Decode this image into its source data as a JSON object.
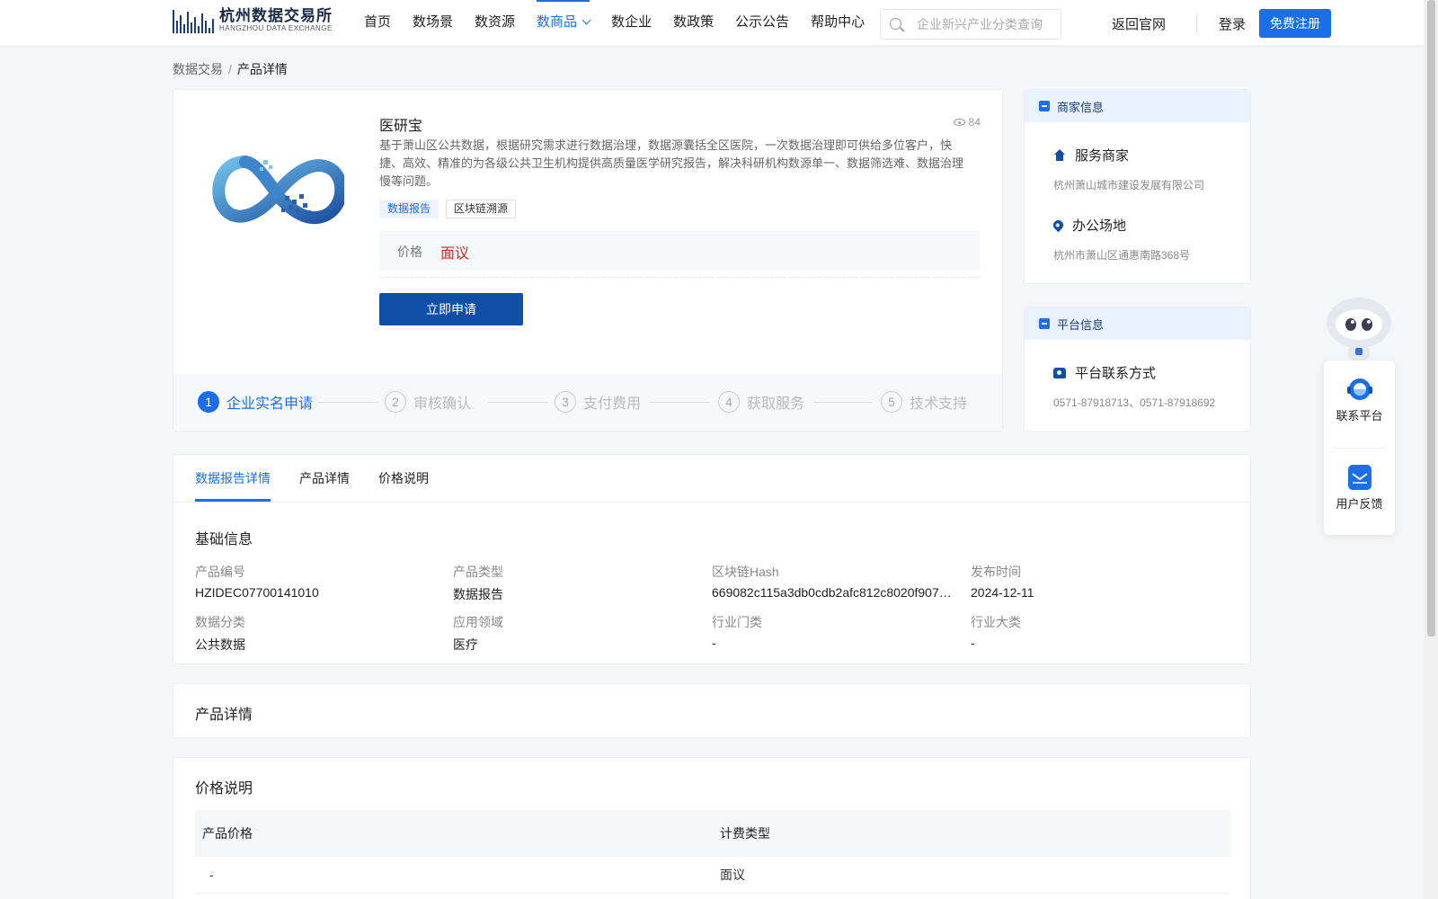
{
  "header": {
    "logo_cn": "杭州数据交易所",
    "logo_en": "HANGZHOU DATA EXCHANGE",
    "nav": [
      "首页",
      "数场景",
      "数资源",
      "数商品",
      "数企业",
      "数政策",
      "公示公告",
      "帮助中心"
    ],
    "active_nav": "数商品",
    "search_placeholder": "企业新兴产业分类查询",
    "back_label": "返回官网",
    "login_label": "登录",
    "register_label": "免费注册"
  },
  "breadcrumb": {
    "root": "数据交易",
    "separator": "/",
    "current": "产品详情"
  },
  "product": {
    "name": "医研宝",
    "views": "84",
    "description": "基于萧山区公共数据，根据研究需求进行数据治理，数据源囊括全区医院，一次数据治理即可供给多位客户，快捷、高效、精准的为各级公共卫生机构提供高质量医学研究报告，解决科研机构数源单一、数据筛选难、数据治理慢等问题。",
    "tags": [
      "数据报告",
      "区块链溯源"
    ],
    "price_label": "价格",
    "price_value": "面议",
    "apply_label": "立即申请",
    "steps": [
      {
        "num": "1",
        "label": "企业实名申请"
      },
      {
        "num": "2",
        "label": "审核确认"
      },
      {
        "num": "3",
        "label": "支付费用"
      },
      {
        "num": "4",
        "label": "获取服务"
      },
      {
        "num": "5",
        "label": "技术支持"
      }
    ]
  },
  "merchant": {
    "title": "商家信息",
    "service_label": "服务商家",
    "service_value": "杭州萧山城市建设发展有限公司",
    "office_label": "办公场地",
    "office_value": "杭州市萧山区通惠南路368号"
  },
  "platform": {
    "title": "平台信息",
    "contact_label": "平台联系方式",
    "contact_value": "0571-87918713、0571-87918692"
  },
  "float_widget": {
    "contact": "联系平台",
    "feedback": "用户反馈"
  },
  "details": {
    "tabs": [
      "数据报告详情",
      "产品详情",
      "价格说明"
    ],
    "basic_title": "基础信息",
    "fields": [
      {
        "key": "产品编号",
        "value": "HZIDEC07700141010"
      },
      {
        "key": "产品类型",
        "value": "数据报告"
      },
      {
        "key": "区块链Hash",
        "value": "669082c115a3db0cdb2afc812c8020f9071…"
      },
      {
        "key": "发布时间",
        "value": "2024-12-11"
      },
      {
        "key": "数据分类",
        "value": "公共数据"
      },
      {
        "key": "应用领域",
        "value": "医疗"
      },
      {
        "key": "行业门类",
        "value": "-"
      },
      {
        "key": "行业大类",
        "value": "-"
      }
    ]
  },
  "product_detail_title": "产品详情",
  "price_section": {
    "title": "价格说明",
    "columns": [
      "产品价格",
      "计费类型"
    ],
    "rows": [
      [
        "-",
        "面议"
      ]
    ]
  }
}
